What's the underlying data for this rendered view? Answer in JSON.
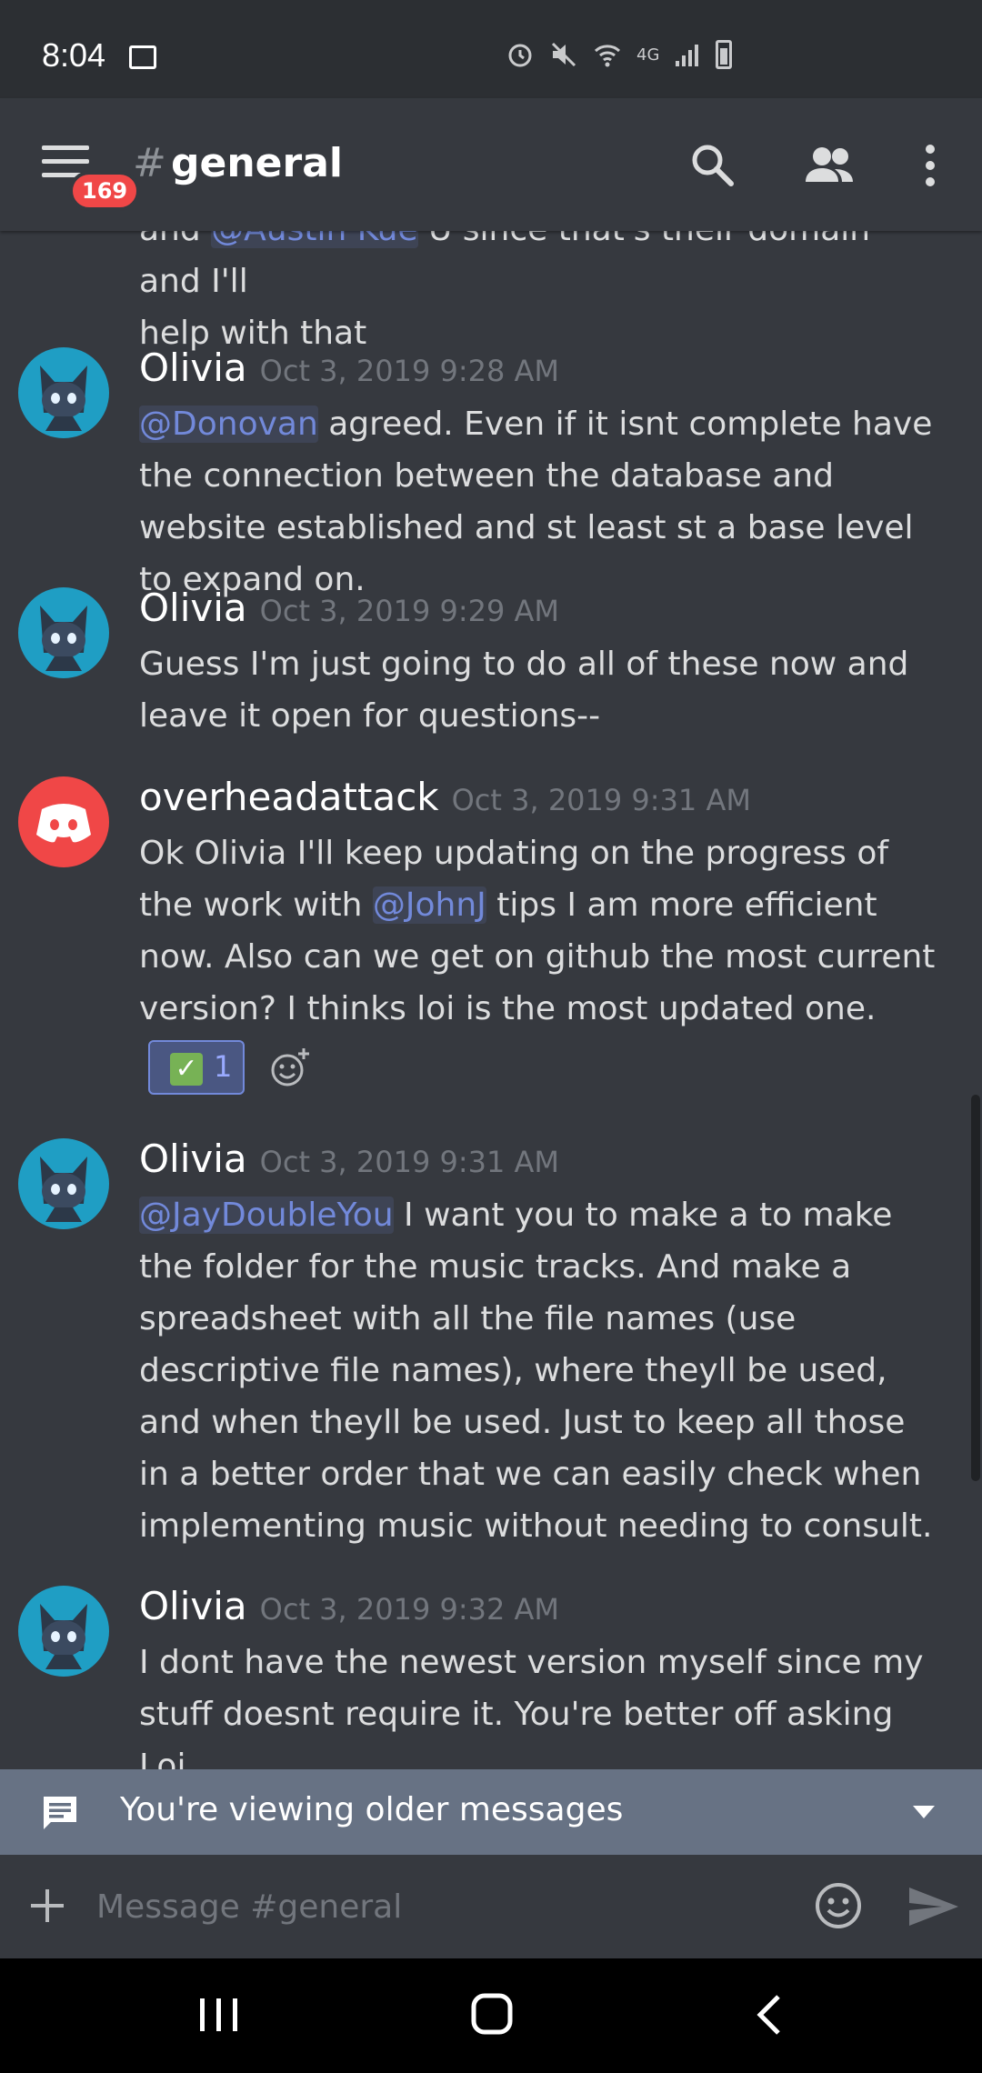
{
  "status_bar": {
    "time": "8:04",
    "network": "4G",
    "icons": [
      "gallery-icon",
      "alarm-icon",
      "mute-icon",
      "wifi-icon",
      "signal-icon",
      "battery-icon"
    ]
  },
  "header": {
    "hash": "#",
    "channel": "general",
    "unread_badge": "169",
    "icons": [
      "menu-icon",
      "search-icon",
      "members-icon",
      "more-icon"
    ]
  },
  "messages": {
    "partial": {
      "line1_pre": "and ",
      "line1_mention": "@Austin Kue",
      "line1_post": " U since that's their domain and I'll",
      "line2": "help with that"
    },
    "m1": {
      "author": "Olivia",
      "timestamp": "Oct 3, 2019 9:28 AM",
      "mention": "@Donovan",
      "text": " agreed. Even if it isnt complete have the connection between the database and website established and st least st a base level to expand on."
    },
    "m2": {
      "author": "Olivia",
      "timestamp": "Oct 3, 2019 9:29 AM",
      "text": "Guess I'm just going to do all of these now and leave it open for questions--"
    },
    "m3": {
      "author": "overheadattack",
      "timestamp": "Oct 3, 2019 9:31 AM",
      "text_pre": "Ok Olivia I'll keep updating on the progress of the work with ",
      "mention": "@JohnJ",
      "text_post": " tips I am more efficient now. Also can we get on github the most current version? I thinks loi is the most updated one.",
      "reaction_count": "1",
      "reaction_emoji": "white-check-mark"
    },
    "m4": {
      "author": "Olivia",
      "timestamp": "Oct 3, 2019 9:31 AM",
      "mention": "@JayDoubleYou",
      "text": " I want you to make a to make the folder for the music tracks. And make a spreadsheet with all the file names (use descriptive file names), where theyll be used, and when theyll be used. Just to keep all those in a better order that we can easily check when implementing music without needing to consult."
    },
    "m5": {
      "author": "Olivia",
      "timestamp": "Oct 3, 2019 9:32 AM",
      "text": "I dont have the newest version myself since my stuff doesnt require it. You're better off asking Loi."
    }
  },
  "older_bar": {
    "text": "You're viewing older messages"
  },
  "composer": {
    "placeholder": "Message #general"
  },
  "colors": {
    "background": "#36393f",
    "mention": "#7289da",
    "badge": "#f04747",
    "older_bar": "#677284"
  }
}
